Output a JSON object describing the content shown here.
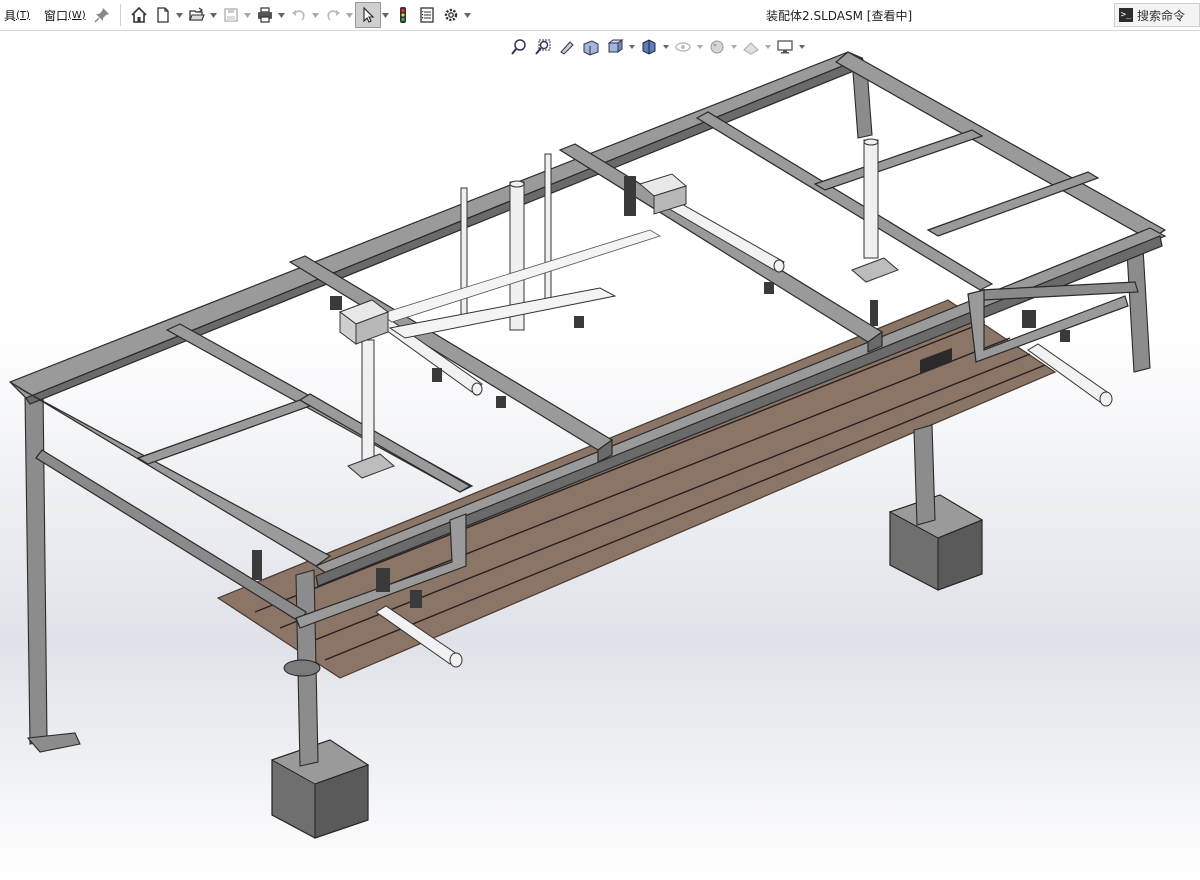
{
  "menu": {
    "tools_label": "具",
    "tools_key": "(T)",
    "window_label": "窗口",
    "window_key": "(W)"
  },
  "toolbar": {
    "icons": [
      "pin-icon",
      "home-icon",
      "new-document-icon",
      "open-folder-icon",
      "save-icon",
      "print-icon",
      "undo-icon",
      "redo-icon",
      "select-arrow-icon",
      "traffic-light-icon",
      "file-properties-icon",
      "gear-icon"
    ]
  },
  "title": {
    "document": "装配体2.SLDASM [查看中]"
  },
  "search": {
    "label": "搜索命令",
    "icon_text": ">_"
  },
  "view_toolbar": {
    "icons": [
      "zoom-to-fit-icon",
      "zoom-area-icon",
      "previous-view-icon",
      "section-view-icon",
      "view-orientation-icon",
      "display-style-icon",
      "hide-show-icon",
      "edit-appearance-icon",
      "apply-scene-icon",
      "view-settings-icon"
    ]
  },
  "colors": {
    "frame": "#8c8c8c",
    "frame_dark": "#555555",
    "wood": "#8a7566",
    "block": "#7a7a7a",
    "cylinder": "#f2f2f2"
  }
}
